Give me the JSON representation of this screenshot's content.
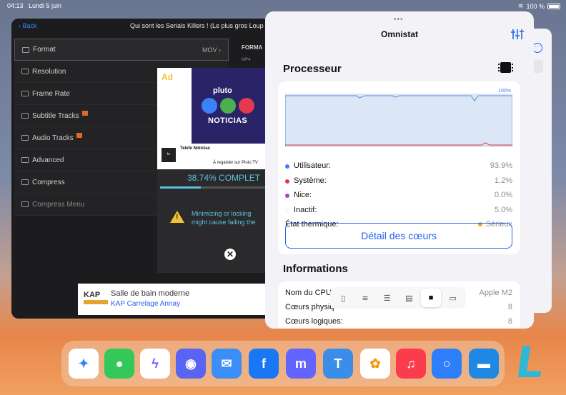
{
  "status_bar": {
    "time": "04:13",
    "date": "Lundi 5 juin",
    "battery": "100 %"
  },
  "app": {
    "back_label": "Back",
    "title": "Qui sont les Serials Killers ! (Le plus gros Loup",
    "format_column_header": "FORMA",
    "format_sub": "MP4",
    "menu": [
      {
        "label": "Format",
        "value": "MOV",
        "selected": true
      },
      {
        "label": "Resolution"
      },
      {
        "label": "Frame Rate"
      },
      {
        "label": "Subtitle Tracks",
        "badge": true
      },
      {
        "label": "Audio Tracks",
        "badge": true
      },
      {
        "label": "Advanced"
      },
      {
        "label": "Compress"
      },
      {
        "label": "Compress Menu",
        "dim": true
      }
    ]
  },
  "ad": {
    "label": "Ad",
    "brand": "pluto",
    "headline": "NOTICIAS",
    "channel_title": "Telefe Noticias",
    "channel_sub": "À regarder sur Pluto TV",
    "progress_text": "38.74% COMPLET",
    "progress_fraction": 0.3874,
    "warning_line1": "Minimizing or locking",
    "warning_line2": "might cause failing the",
    "close_glyph": "✕"
  },
  "banner": {
    "logo": "KAP",
    "title": "Salle de bain moderne",
    "subtitle": "KAP Carrelage Annay"
  },
  "omnistat": {
    "title": "Omnistat",
    "grabber": "•••",
    "processor_title": "Processeur",
    "graph_max_label": "100%",
    "stats": [
      {
        "label": "Utilisateur:",
        "value": "93.9%",
        "color": "#3b82f6"
      },
      {
        "label": "Système:",
        "value": "1.2%",
        "color": "#e53935"
      },
      {
        "label": "Nice:",
        "value": "0.0%",
        "color": "#9c4dcc"
      },
      {
        "label": "Inactif:",
        "value": "5.0%",
        "color": "#ffffff"
      }
    ],
    "thermal_label": "État thermique:",
    "thermal_value": "Sérieux",
    "thermal_color": "#f0a030",
    "detail_button": "Détail des cœurs",
    "info_title": "Informations",
    "info_rows": [
      {
        "label": "Nom du CPU",
        "value": "Apple M2"
      },
      {
        "label": "Cœurs physiq",
        "value": "8"
      },
      {
        "label": "Cœurs logiques:",
        "value": "8"
      }
    ]
  },
  "toolbar_icons": [
    "device-icon",
    "wifi-icon",
    "storage-icon",
    "memory-icon",
    "cpu-icon",
    "battery-icon"
  ],
  "dock_apps": [
    {
      "name": "safari",
      "color": "#ffffff"
    },
    {
      "name": "messages",
      "color": "#34c759"
    },
    {
      "name": "messenger",
      "color": "#7b5cff"
    },
    {
      "name": "discord",
      "color": "#5865f2"
    },
    {
      "name": "mail",
      "color": "#3a8ef5"
    },
    {
      "name": "facebook",
      "color": "#1877f2"
    },
    {
      "name": "mastodon",
      "color": "#6364ff"
    },
    {
      "name": "tweetbot",
      "color": "#3b8ee8"
    },
    {
      "name": "photos",
      "color": "#ffffff"
    },
    {
      "name": "music",
      "color": "#fa3c4c"
    },
    {
      "name": "ring-app",
      "color": "#2d7ff9"
    },
    {
      "name": "files",
      "color": "#1e88e5"
    }
  ]
}
